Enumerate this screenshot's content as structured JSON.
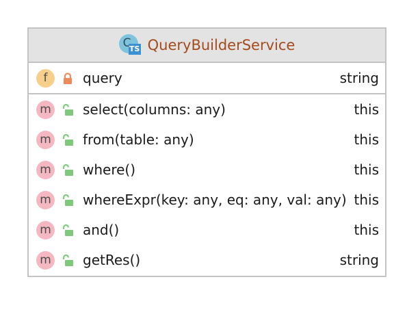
{
  "class": {
    "name": "QueryBuilderService",
    "icon": "typescript-class-icon",
    "icon_letter": "C",
    "icon_badge": "TS",
    "name_color": "#a44a1d"
  },
  "colors": {
    "header_bg": "#e3e3e3",
    "border": "#c3c3c3",
    "field_icon": "#f7cf8d",
    "method_icon": "#f5b8c2",
    "private_lock": "#ee8a5b",
    "public_lock": "#7ec97a",
    "class_icon_bg": "#7fc3dc",
    "ts_badge_bg": "#3b8fd3"
  },
  "fields": [
    {
      "kind": "f",
      "visibility": "private",
      "name": "query",
      "type": "string"
    }
  ],
  "methods": [
    {
      "kind": "m",
      "visibility": "public",
      "name": "select(columns: any)",
      "type": "this"
    },
    {
      "kind": "m",
      "visibility": "public",
      "name": "from(table: any)",
      "type": "this"
    },
    {
      "kind": "m",
      "visibility": "public",
      "name": "where()",
      "type": "this"
    },
    {
      "kind": "m",
      "visibility": "public",
      "name": "whereExpr(key: any, eq: any, val: any)",
      "type": "this"
    },
    {
      "kind": "m",
      "visibility": "public",
      "name": "and()",
      "type": "this"
    },
    {
      "kind": "m",
      "visibility": "public",
      "name": "getRes()",
      "type": "string"
    }
  ]
}
